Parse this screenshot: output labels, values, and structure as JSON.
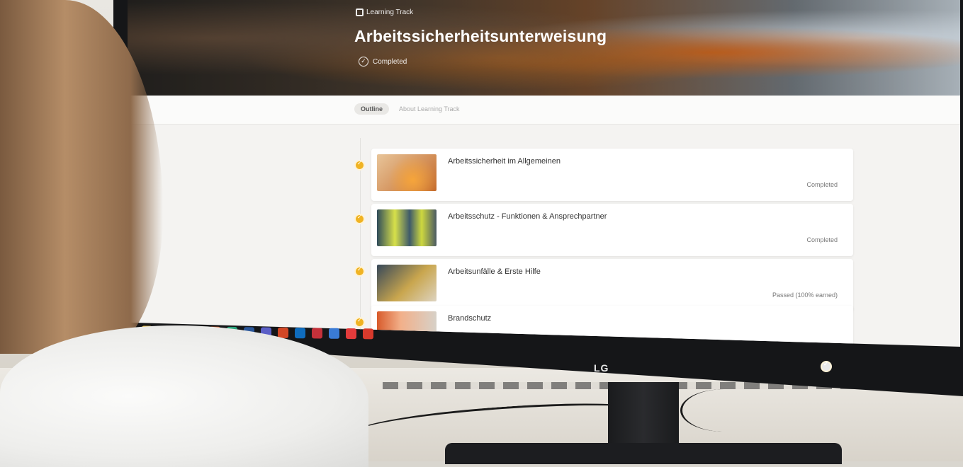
{
  "hero": {
    "label": "Learning Track",
    "title": "Arbeitssicherheitsunterweisung",
    "status": "Completed"
  },
  "tabs": [
    {
      "label": "Outline",
      "active": true
    },
    {
      "label": "About Learning Track",
      "active": false
    }
  ],
  "modules": [
    {
      "title": "Arbeitssicherheit im Allgemeinen",
      "status": "Completed"
    },
    {
      "title": "Arbeitsschutz - Funktionen & Ansprechpartner",
      "status": "Completed"
    },
    {
      "title": "Arbeitsunfälle & Erste Hilfe",
      "status": "Passed (100% earned)"
    },
    {
      "title": "Brandschutz",
      "status": ""
    }
  ],
  "monitor": {
    "brand": "LG"
  },
  "colors": {
    "accent": "#f0b323"
  },
  "taskbar_icons": [
    "file-explorer-icon",
    "store-icon",
    "mail-icon",
    "chrome-icon",
    "app-icon",
    "edge-icon",
    "word-icon",
    "teams-icon",
    "powerpoint-icon",
    "outlook-icon",
    "excel-icon",
    "calendar-icon",
    "pdf-icon",
    "acrobat-icon"
  ]
}
